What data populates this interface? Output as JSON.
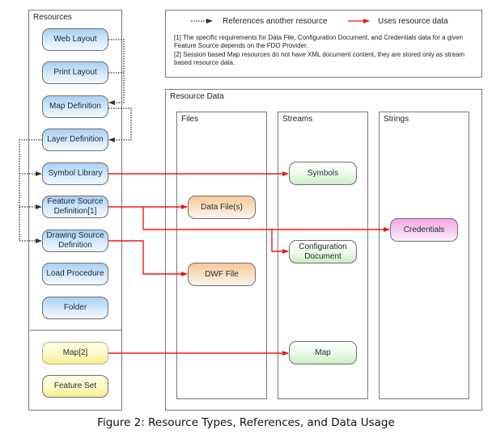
{
  "resources_panel": {
    "title": "Resources",
    "items": [
      {
        "label": "Web Layout"
      },
      {
        "label": "Print Layout"
      },
      {
        "label": "Map Definition"
      },
      {
        "label": "Layer Definition"
      },
      {
        "label": "Symbol Library"
      },
      {
        "label": "Feature Source Definition[1]"
      },
      {
        "label": "Drawing Source Definition"
      },
      {
        "label": "Load Procedure"
      },
      {
        "label": "Folder"
      }
    ],
    "session_items": [
      {
        "label": "Map[2]"
      },
      {
        "label": "Feature Set"
      }
    ]
  },
  "legend": {
    "reference_label": "References another resource",
    "uses_label": "Uses resource data",
    "notes": [
      "[1] The specific requirements for Data File, Configuration Document, and Credentials data for a given Feature Source depends on the FDO Provider.",
      "[2] Session based Map resources do not have XML document content, they are stored only as stream based resource data."
    ]
  },
  "resource_data": {
    "title": "Resource Data",
    "files": {
      "title": "Files",
      "items": [
        {
          "label": "Data File(s)"
        },
        {
          "label": "DWF File"
        }
      ]
    },
    "streams": {
      "title": "Streams",
      "items": [
        {
          "label": "Symbols"
        },
        {
          "label": "Configuration Document"
        },
        {
          "label": "Map"
        }
      ]
    },
    "strings": {
      "title": "Strings",
      "items": [
        {
          "label": "Credentials"
        }
      ]
    }
  },
  "colors": {
    "uses_arrow": "#e8191b",
    "reference_arrow": "#333333"
  },
  "caption": "Figure 2: Resource Types, References, and Data Usage"
}
